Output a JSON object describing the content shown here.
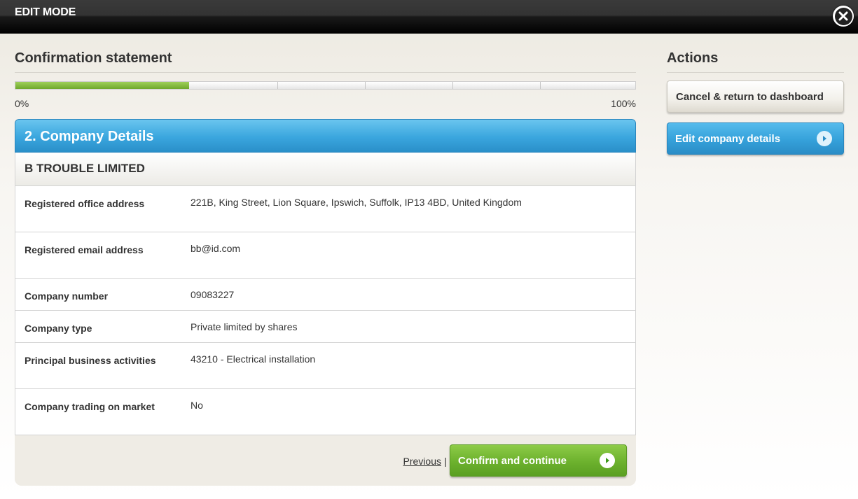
{
  "topbar": {
    "title": "EDIT MODE"
  },
  "main": {
    "title": "Confirmation statement",
    "progress": {
      "value_percent": 28,
      "min_label": "0%",
      "max_label": "100%"
    },
    "card": {
      "header": "2. Company Details",
      "company_name": "B TROUBLE LIMITED",
      "rows": [
        {
          "label": "Registered office address",
          "value": "221B, King Street, Lion Square, Ipswich, Suffolk, IP13 4BD, United Kingdom"
        },
        {
          "label": "Registered email address",
          "value": "bb@id.com"
        },
        {
          "label": "Company number",
          "value": "09083227"
        },
        {
          "label": "Company type",
          "value": "Private limited by shares"
        },
        {
          "label": "Principal business activities",
          "value": "43210 - Electrical installation"
        },
        {
          "label": "Company trading on market",
          "value": "No"
        }
      ],
      "footer": {
        "previous_label": "Previous",
        "separator": "|",
        "confirm_label": "Confirm and continue"
      }
    }
  },
  "side": {
    "title": "Actions",
    "cancel_label": "Cancel & return to dashboard",
    "edit_label": "Edit company details"
  },
  "colors": {
    "progress_fill": "#7ab536",
    "header_blue": "#3aa6de",
    "confirm_green": "#6cb12d"
  },
  "icons": {
    "close": "close-icon",
    "arrow": "arrow-right-icon"
  }
}
